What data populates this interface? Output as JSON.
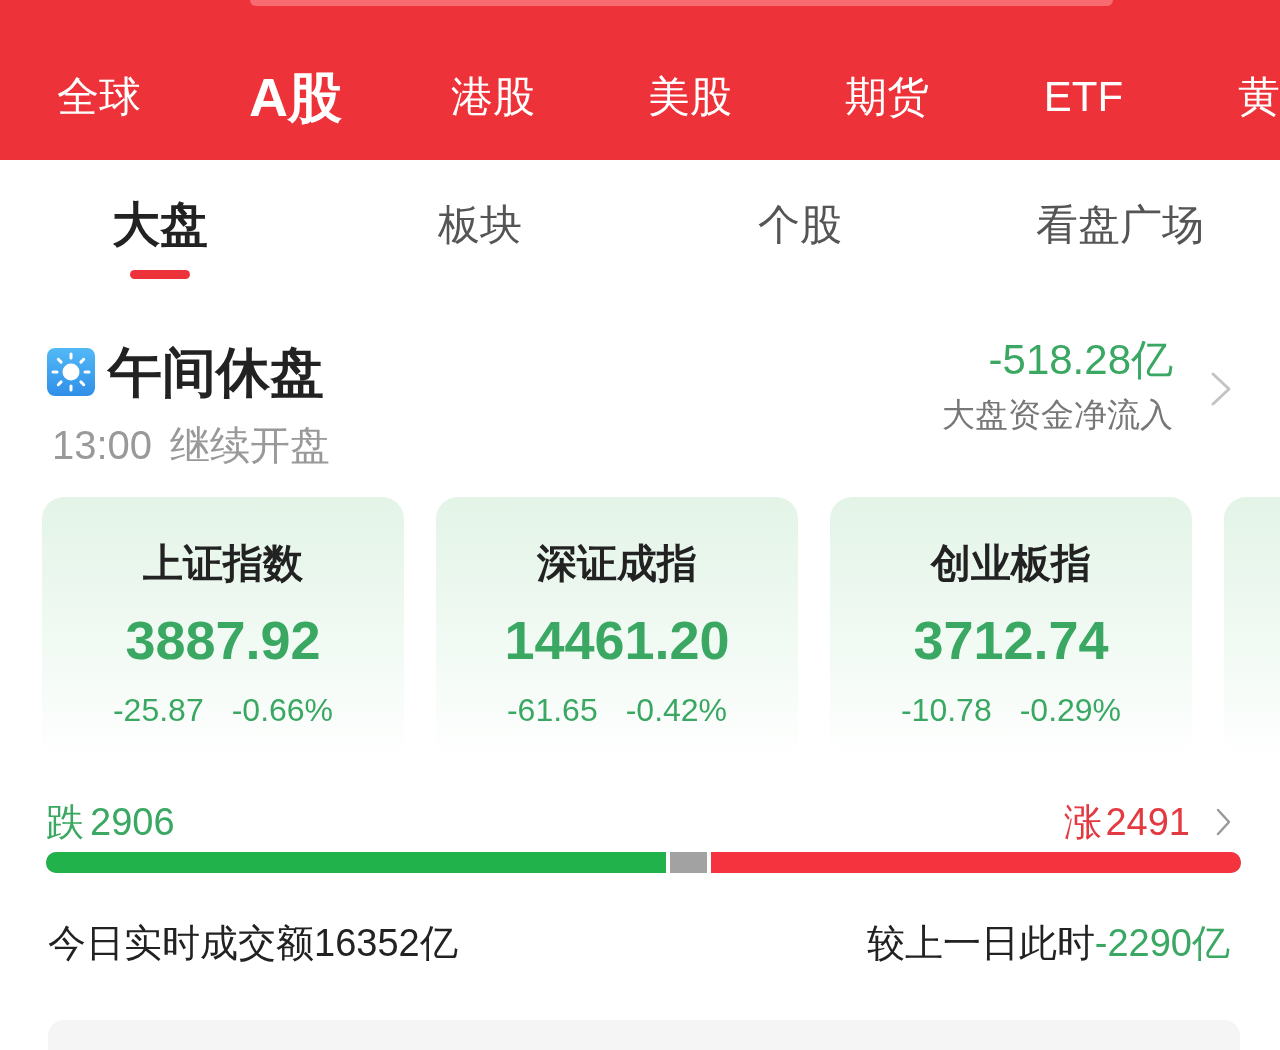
{
  "market_tabs": [
    {
      "label": "全球",
      "selected": false
    },
    {
      "label": "A股",
      "selected": true
    },
    {
      "label": "港股",
      "selected": false
    },
    {
      "label": "美股",
      "selected": false
    },
    {
      "label": "期货",
      "selected": false
    },
    {
      "label": "ETF",
      "selected": false
    },
    {
      "label": "黄",
      "selected": false
    }
  ],
  "view_tabs": [
    {
      "label": "大盘",
      "selected": true
    },
    {
      "label": "板块",
      "selected": false
    },
    {
      "label": "个股",
      "selected": false
    },
    {
      "label": "看盘广场",
      "selected": false
    }
  ],
  "session": {
    "title": "午间休盘",
    "resume_time": "13:00",
    "resume_text": "继续开盘"
  },
  "net_flow": {
    "value": "-518.28亿",
    "label": "大盘资金净流入",
    "falling": true
  },
  "indices": [
    {
      "name": "上证指数",
      "value": "3887.92",
      "change": "-25.87",
      "change_pct": "-0.66%",
      "falling": true
    },
    {
      "name": "深证成指",
      "value": "14461.20",
      "change": "-61.65",
      "change_pct": "-0.42%",
      "falling": true
    },
    {
      "name": "创业板指",
      "value": "3712.74",
      "change": "-10.78",
      "change_pct": "-0.29%",
      "falling": true
    }
  ],
  "breadth": {
    "fall": {
      "label": "跌",
      "count": "2906",
      "level": 0.522
    },
    "rise": {
      "label": "涨",
      "count": "2491",
      "level": 0.447
    }
  },
  "turnover": {
    "label": "今日实时成交额16352亿",
    "compare_label": "较上一日此时",
    "compare_value": "-2290亿",
    "falling": true
  }
}
